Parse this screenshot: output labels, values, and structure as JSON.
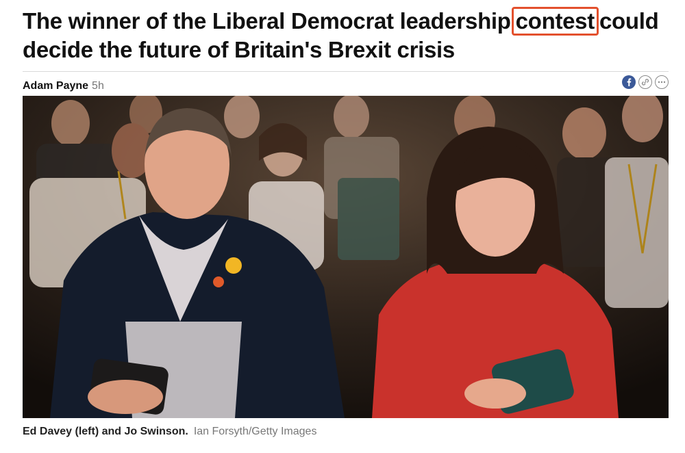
{
  "article": {
    "headline_before": "The winner of the Liberal Democrat leadership",
    "headline_highlight": "contest",
    "headline_after": "could decide the future of Britain's Brexit crisis",
    "highlight_color": "#e3502d"
  },
  "byline": {
    "author": "Adam Payne",
    "time": "5h"
  },
  "share": {
    "facebook_icon": "facebook-icon",
    "link_icon": "link-icon",
    "more_icon": "more-icon"
  },
  "photo": {
    "subject": "crowd-scene"
  },
  "caption": {
    "subjects": "Ed Davey (left) and Jo Swinson.",
    "credit": "Ian Forsyth/Getty Images"
  }
}
